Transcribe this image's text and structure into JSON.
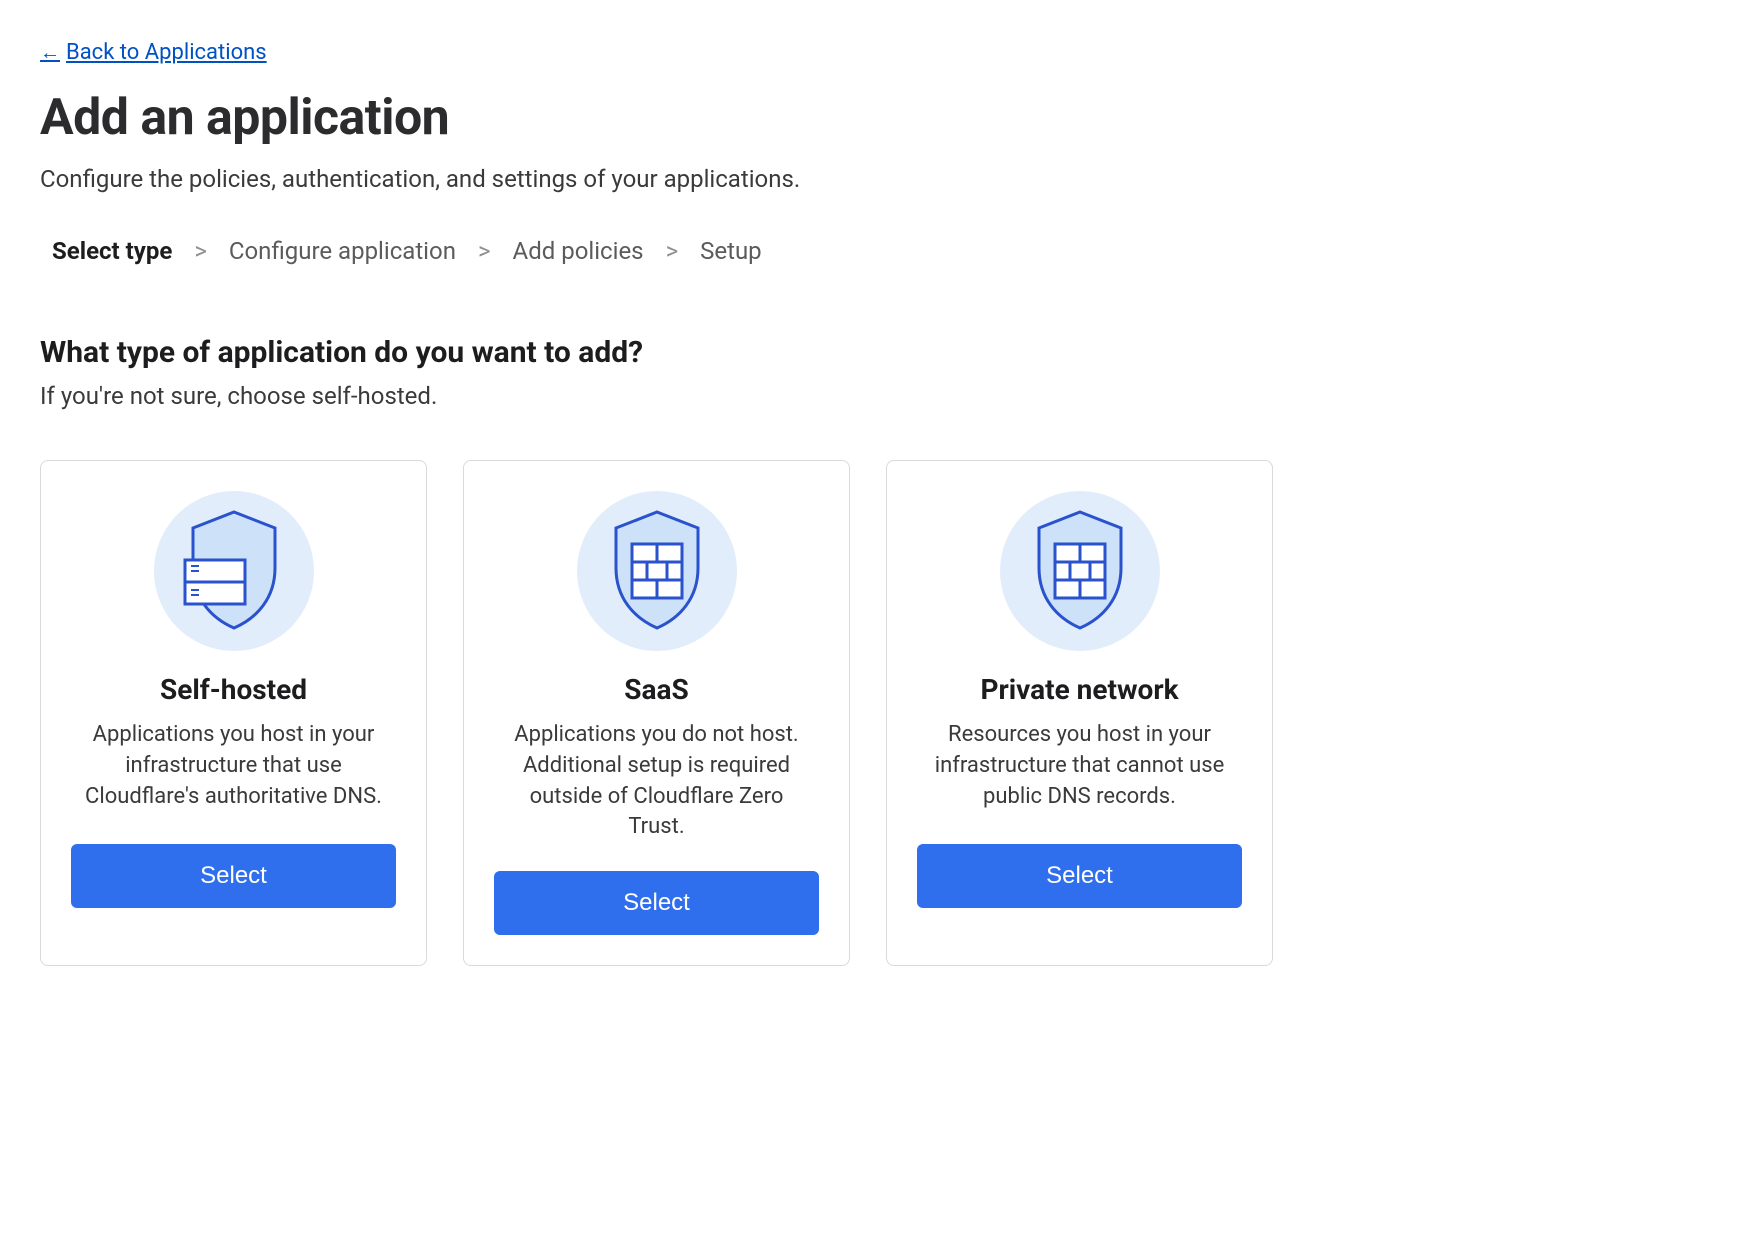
{
  "back_link": {
    "label": "Back to Applications",
    "arrow": "←"
  },
  "page": {
    "title": "Add an application",
    "subtitle": "Configure the policies, authentication, and settings of your applications."
  },
  "breadcrumb": {
    "steps": [
      {
        "label": "Select type",
        "active": true
      },
      {
        "label": "Configure application",
        "active": false
      },
      {
        "label": "Add policies",
        "active": false
      },
      {
        "label": "Setup",
        "active": false
      }
    ],
    "separator": ">"
  },
  "section": {
    "heading": "What type of application do you want to add?",
    "sub": "If you're not sure, choose self-hosted."
  },
  "cards": [
    {
      "id": "self-hosted",
      "icon": "shield-server-icon",
      "title": "Self-hosted",
      "description": "Applications you host in your infrastructure that use Cloudflare's authoritative DNS.",
      "button": "Select"
    },
    {
      "id": "saas",
      "icon": "shield-wall-icon",
      "title": "SaaS",
      "description": "Applications you do not host. Additional setup is required outside of Cloudflare Zero Trust.",
      "button": "Select"
    },
    {
      "id": "private-network",
      "icon": "shield-wall-icon",
      "title": "Private network",
      "description": "Resources you host in your infrastructure that cannot use public DNS records.",
      "button": "Select"
    }
  ],
  "colors": {
    "accent": "#2f6fed",
    "link": "#0051c3",
    "icon_bg": "#e1edfb",
    "icon_stroke": "#2952cc",
    "icon_fill": "#cde1f9"
  }
}
